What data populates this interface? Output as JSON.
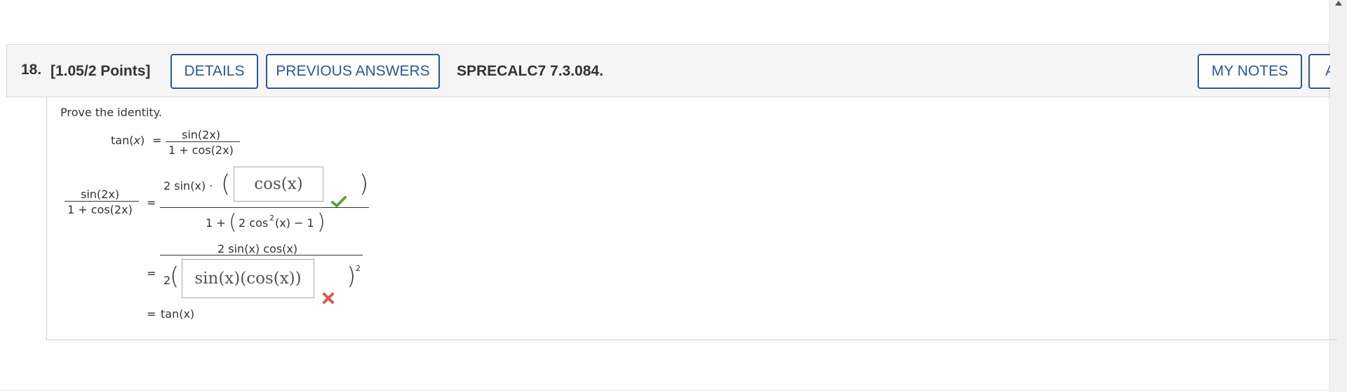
{
  "question": {
    "number": "18.",
    "points": "[1.05/2 Points]",
    "details_label": "DETAILS",
    "previous_answers_label": "PREVIOUS ANSWERS",
    "code": "SPRECALC7 7.3.084.",
    "my_notes_label": "MY NOTES",
    "cut_button_label": "A"
  },
  "prompt": "Prove the identity.",
  "identity": {
    "lhs_fn": "tan(",
    "lhs_var": "x",
    "lhs_close": ")",
    "equals": "=",
    "num": "sin(2x)",
    "den": "1 + cos(2x)"
  },
  "steps": {
    "step1": {
      "left_num": "sin(2x)",
      "left_den": "1 + cos(2x)",
      "equals": "=",
      "num_prefix": "2 sin(x) ·",
      "answer": "cos(x)",
      "den_prefix": "1 +",
      "den_inner": "2 cos",
      "den_exp": "2",
      "den_tail": "(x) − 1",
      "status": "correct"
    },
    "step2": {
      "equals": "=",
      "num": "2 sin(x) cos(x)",
      "den_prefix": "2",
      "answer": "sin(x)(cos(x))",
      "exponent": "2",
      "status": "incorrect"
    },
    "step3": {
      "equals": "=",
      "result": "tan(x)"
    }
  },
  "colors": {
    "accent": "#2b5797",
    "correct": "#5fa33a",
    "incorrect": "#e05252",
    "header_bg": "#f5f5f5"
  },
  "icons": {
    "check": "check-icon",
    "cross": "cross-icon",
    "scroll_up": "scroll-up-arrow-icon"
  }
}
